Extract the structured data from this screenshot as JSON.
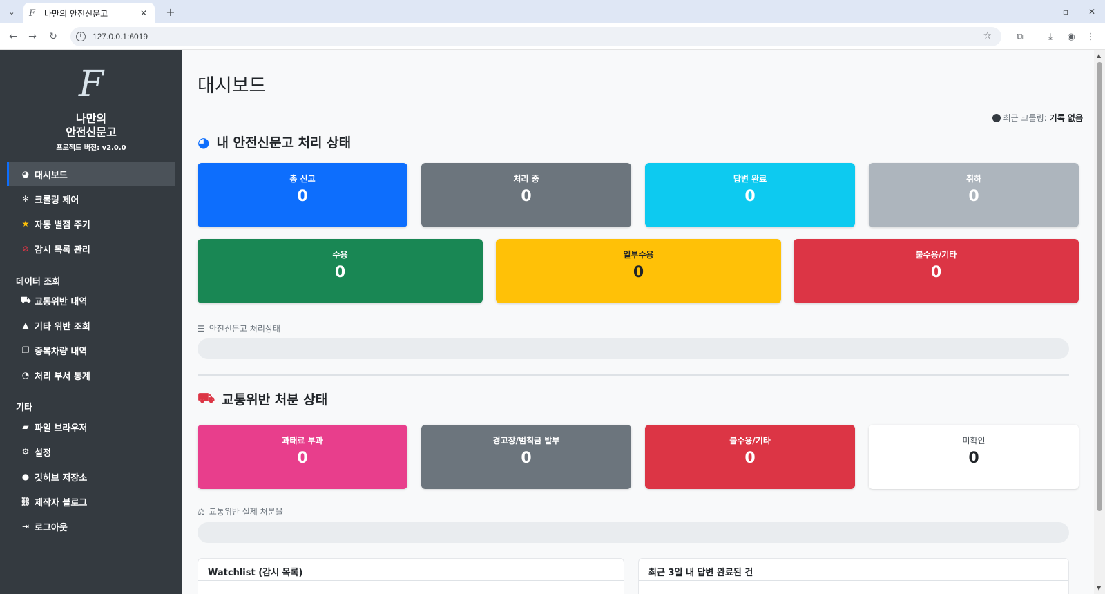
{
  "browser": {
    "tab_title": "나만의 안전신문고",
    "favicon": "F",
    "url": "127.0.0.1:6019",
    "icons": [
      "tab-list-icon",
      "close-icon",
      "new-tab-icon",
      "minimize-icon",
      "maximize-icon",
      "window-close-icon",
      "back-icon",
      "forward-icon",
      "reload-icon",
      "site-info-icon",
      "bookmark-star-icon",
      "extensions-icon",
      "download-icon",
      "profile-icon",
      "menu-icon"
    ]
  },
  "sidebar": {
    "logo": "F",
    "brand_line1": "나만의",
    "brand_line2": "안전신문고",
    "version": "프로젝트 버전: v2.0.0",
    "items": [
      {
        "label": "대시보드",
        "icon": "dashboard-icon",
        "active": true
      },
      {
        "label": "크롤링 제어",
        "icon": "bug-icon"
      },
      {
        "label": "자동 별점 주기",
        "icon": "star-icon"
      },
      {
        "label": "감시 목록 관리",
        "icon": "eye-slash-icon"
      }
    ],
    "section_data": "데이터 조회",
    "data_items": [
      {
        "label": "교통위반 내역",
        "icon": "car-icon"
      },
      {
        "label": "기타 위반 조회",
        "icon": "warning-icon"
      },
      {
        "label": "중복차량 내역",
        "icon": "copy-icon"
      },
      {
        "label": "처리 부서 통계",
        "icon": "pie-chart-icon"
      }
    ],
    "section_other": "기타",
    "other_items": [
      {
        "label": "파일 브라우저",
        "icon": "folder-icon"
      },
      {
        "label": "설정",
        "icon": "gear-icon"
      },
      {
        "label": "깃허브 저장소",
        "icon": "github-icon"
      },
      {
        "label": "제작자 블로그",
        "icon": "link-icon"
      },
      {
        "label": "로그아웃",
        "icon": "logout-icon"
      }
    ]
  },
  "main": {
    "page_title": "대시보드",
    "crawl_label": "최근 크롤링:",
    "crawl_value": "기록 없음",
    "report_section": {
      "title": "내 안전신문고 처리 상태",
      "cards_row1": [
        {
          "label": "총 신고",
          "value": "0",
          "color": "#0d6efd"
        },
        {
          "label": "처리 중",
          "value": "0",
          "color": "#6c757d"
        },
        {
          "label": "답변 완료",
          "value": "0",
          "color": "#0dcaf0"
        },
        {
          "label": "취하",
          "value": "0",
          "color": "#adb5bd"
        }
      ],
      "cards_row2": [
        {
          "label": "수용",
          "value": "0",
          "color": "#198754"
        },
        {
          "label": "일부수용",
          "value": "0",
          "color": "#ffc107"
        },
        {
          "label": "불수용/기타",
          "value": "0",
          "color": "#dc3545"
        }
      ],
      "bar_label": "안전신문고 처리상태",
      "bar_percent": 0
    },
    "traffic_section": {
      "title": "교통위반 처분 상태",
      "cards": [
        {
          "label": "과태료 부과",
          "value": "0",
          "color": "#e83e8c"
        },
        {
          "label": "경고장/범칙금 발부",
          "value": "0",
          "color": "#6c757d"
        },
        {
          "label": "불수용/기타",
          "value": "0",
          "color": "#dc3545"
        },
        {
          "label": "미확인",
          "value": "0",
          "color": "#ffffff"
        }
      ],
      "bar_label": "교통위반 실제 처분율",
      "bar_percent": 0
    },
    "panels": {
      "watchlist_title": "Watchlist (감시 목록)",
      "recent_title": "최근 3일 내 답변 완료된 건"
    }
  }
}
